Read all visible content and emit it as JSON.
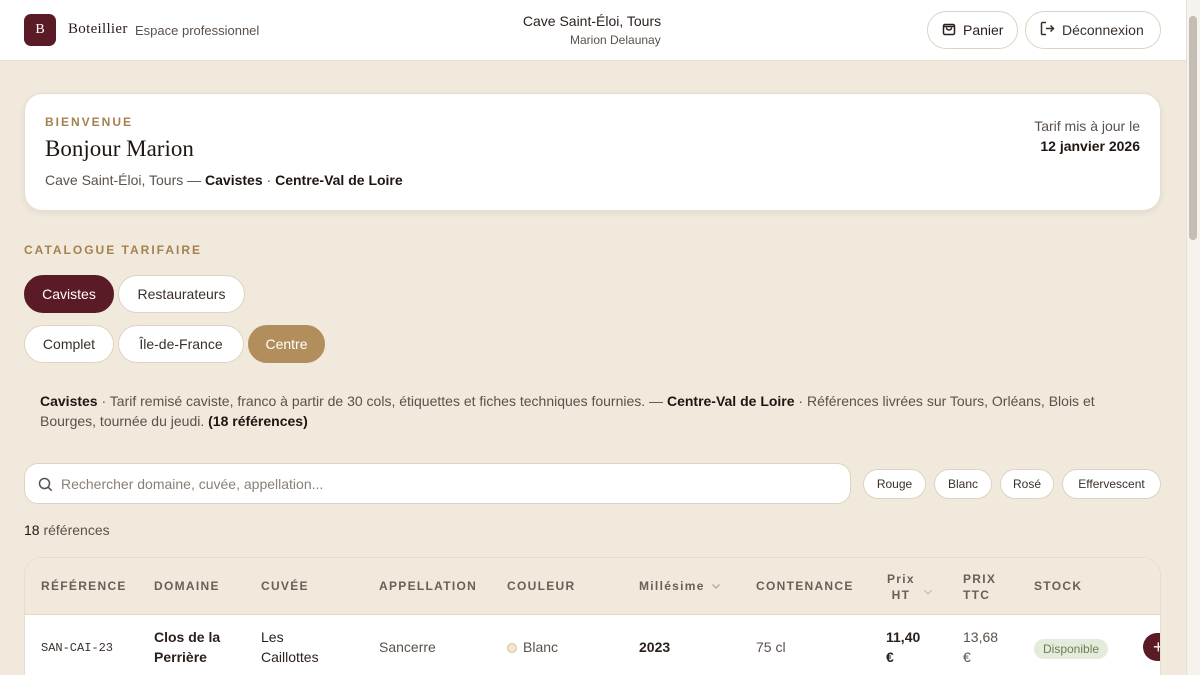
{
  "header": {
    "logo_letter": "B",
    "brand": "Boteillier",
    "brand_sub": "Espace professionnel",
    "store_name": "Cave Saint-Éloi, Tours",
    "store_user": "Marion Delaunay",
    "cart_label": "Panier",
    "logout_label": "Déconnexion"
  },
  "welcome": {
    "eyebrow": "BIENVENUE",
    "title": "Bonjour Marion",
    "sub_prefix": "Cave Saint-Éloi, Tours — ",
    "sub_segment": "Cavistes",
    "sub_sep": " · ",
    "sub_region": "Centre-Val de Loire",
    "tarif_label": "Tarif mis à jour le",
    "tarif_date": "12 janvier 2026"
  },
  "catalogue": {
    "label": "CATALOGUE TARIFAIRE",
    "segments": [
      {
        "label": "Cavistes",
        "active": true
      },
      {
        "label": "Restaurateurs",
        "active": false
      }
    ],
    "regions": [
      {
        "label": "Complet",
        "active": false
      },
      {
        "label": "Île-de-France",
        "active": false
      },
      {
        "label": "Centre",
        "active": true
      }
    ],
    "desc_segment": "Cavistes",
    "desc_segment_text": " · Tarif remisé caviste, franco à partir de 30 cols, étiquettes et fiches techniques fournies. — ",
    "desc_region": "Centre-Val de Loire",
    "desc_region_text": " · Références livrées sur Tours, Orléans, Blois et Bourges, tournée du jeudi. ",
    "desc_count": "(18 références)"
  },
  "search": {
    "placeholder": "Rechercher domaine, cuvée, appellation...",
    "value": ""
  },
  "filters": [
    "Rouge",
    "Blanc",
    "Rosé",
    "Effervescent"
  ],
  "results": {
    "count": "18",
    "label": " références"
  },
  "table": {
    "columns": {
      "reference": "RÉFÉRENCE",
      "domaine": "DOMAINE",
      "cuvee": "CUVÉE",
      "appellation": "APPELLATION",
      "couleur": "COULEUR",
      "millesime": "Millésime",
      "contenance": "CONTENANCE",
      "prix_ht_1": "Prix",
      "prix_ht_2": "HT",
      "prix_ttc_1": "PRIX",
      "prix_ttc_2": "TTC",
      "stock": "STOCK"
    },
    "rows": [
      {
        "reference": "SAN-CAI-23",
        "domaine_1": "Clos de la",
        "domaine_2": "Perrière",
        "cuvee_1": "Les",
        "cuvee_2": "Caillottes",
        "appellation": "Sancerre",
        "couleur": "Blanc",
        "millesime": "2023",
        "contenance": "75 cl",
        "prix_ht_1": "11,40",
        "prix_ht_2": "€",
        "prix_ttc_1": "13,68",
        "prix_ttc_2": "€",
        "stock": "Disponible",
        "add": "+"
      }
    ]
  },
  "colors": {
    "accent_dark": "#5a1a26",
    "accent_gold": "#b18e5c",
    "background": "#f0e9dc"
  }
}
